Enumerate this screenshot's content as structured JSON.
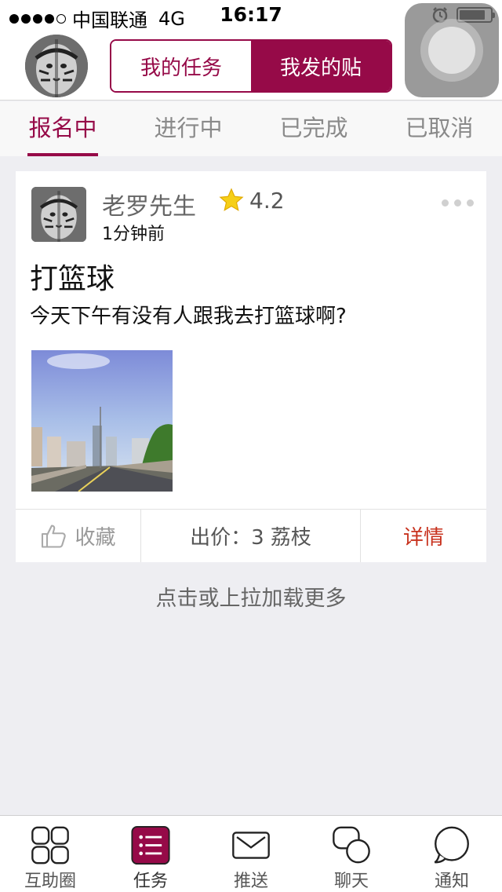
{
  "status_bar": {
    "carrier": "中国联通",
    "network": "4G",
    "time": "16:17",
    "battery_level": 0.85
  },
  "header": {
    "segments": [
      {
        "label": "我的任务",
        "active": false
      },
      {
        "label": "我发的贴",
        "active": true
      }
    ]
  },
  "filter_tabs": [
    {
      "label": "报名中",
      "active": true
    },
    {
      "label": "进行中",
      "active": false
    },
    {
      "label": "已完成",
      "active": false
    },
    {
      "label": "已取消",
      "active": false
    }
  ],
  "post": {
    "author": "老罗先生",
    "rating": "4.2",
    "time": "1分钟前",
    "title": "打篮球",
    "body": "今天下午有没有人跟我去打篮球啊?",
    "actions": {
      "favorite": "收藏",
      "price": "出价：3 荔枝",
      "detail": "详情"
    }
  },
  "load_more": "点击或上拉加载更多",
  "tabbar": [
    {
      "label": "互助圈",
      "icon": "grid-icon",
      "active": false
    },
    {
      "label": "任务",
      "icon": "task-list-icon",
      "active": true
    },
    {
      "label": "推送",
      "icon": "envelope-icon",
      "active": false
    },
    {
      "label": "聊天",
      "icon": "chat-bubbles-icon",
      "active": false
    },
    {
      "label": "通知",
      "icon": "notification-bubble-icon",
      "active": false
    }
  ],
  "colors": {
    "brand": "#960a48",
    "detail_red": "#c8321e",
    "background": "#eeeef2"
  }
}
